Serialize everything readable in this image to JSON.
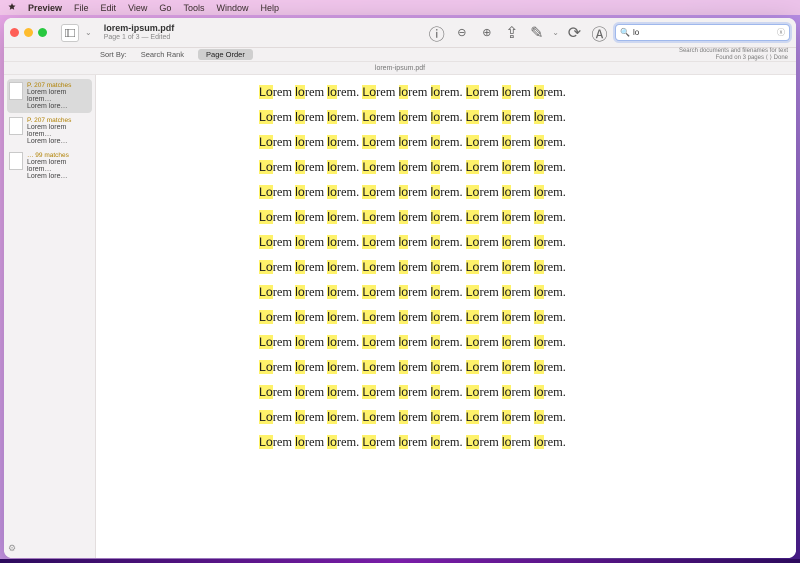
{
  "menubar": {
    "items": [
      "Preview",
      "File",
      "Edit",
      "View",
      "Go",
      "Tools",
      "Window",
      "Help"
    ]
  },
  "toolbar": {
    "title": "lorem-ipsum.pdf",
    "subtitle": "Page 1 of 3 — Edited"
  },
  "search": {
    "value": "lo",
    "hint_line1": "Search documents and filenames for text",
    "hint_line2": "Found on 3 pages ⟨ ⟩  Done"
  },
  "sortbar": {
    "label": "Sort By:",
    "btn_rank": "Search Rank",
    "btn_order": "Page Order"
  },
  "pathbar": {
    "text": "lorem-ipsum.pdf"
  },
  "sidebar": {
    "items": [
      {
        "matches_prefix": "P.",
        "matches": "207 matches",
        "line1": "Lorem lorem",
        "line2": "lorem…",
        "line3": "Lorem lore…"
      },
      {
        "matches_prefix": "P.",
        "matches": "207 matches",
        "line1": "Lorem lorem",
        "line2": "lorem…",
        "line3": "Lorem lore…"
      },
      {
        "matches_prefix": "…",
        "matches": "99 matches",
        "line1": "Lorem lorem",
        "line2": "lorem…",
        "line3": "Lorem lore…"
      }
    ]
  },
  "document": {
    "highlight": "Lo",
    "lines": [
      "Lorem lorem lorem. Lorem lorem lorem. Lorem lorem lorem.",
      "Lorem lorem lorem. Lorem lorem lorem. Lorem lorem lorem.",
      "Lorem lorem lorem. Lorem lorem lorem. Lorem lorem lorem.",
      "Lorem lorem lorem. Lorem lorem lorem. Lorem lorem lorem.",
      "Lorem lorem lorem. Lorem lorem lorem. Lorem lorem lorem.",
      "Lorem lorem lorem. Lorem lorem lorem. Lorem lorem lorem.",
      "Lorem lorem lorem. Lorem lorem lorem. Lorem lorem lorem.",
      "Lorem lorem lorem. Lorem lorem lorem. Lorem lorem lorem.",
      "Lorem lorem lorem. Lorem lorem lorem. Lorem lorem lorem.",
      "Lorem lorem lorem. Lorem lorem lorem. Lorem lorem lorem.",
      "Lorem lorem lorem. Lorem lorem lorem. Lorem lorem lorem.",
      "Lorem lorem lorem. Lorem lorem lorem. Lorem lorem lorem.",
      "Lorem lorem lorem. Lorem lorem lorem. Lorem lorem lorem.",
      "Lorem lorem lorem. Lorem lorem lorem. Lorem lorem lorem.",
      "Lorem lorem lorem. Lorem lorem lorem. Lorem lorem lorem."
    ]
  }
}
